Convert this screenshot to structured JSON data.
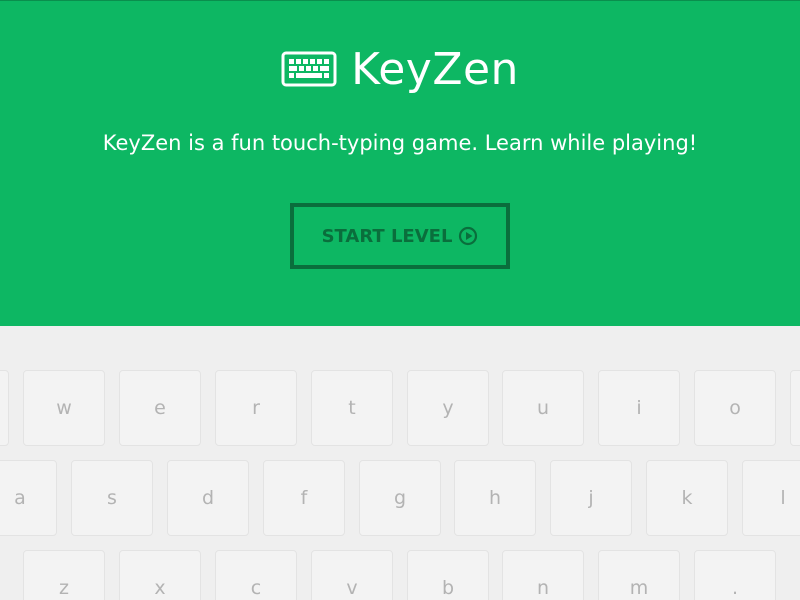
{
  "app": {
    "title": "KeyZen",
    "tagline": "KeyZen is a fun touch-typing game. Learn while playing!",
    "start_button_label": "START LEVEL",
    "colors": {
      "hero_background": "#0db763",
      "button_border": "#0a6e3c",
      "keyboard_background": "#efefef",
      "key_label": "#b3b3b3"
    },
    "icons": {
      "title": "keyboard-icon",
      "start_button": "play-circle-icon"
    }
  },
  "keyboard": {
    "row1": [
      "w",
      "e",
      "r",
      "t",
      "y",
      "u",
      "i",
      "o"
    ],
    "row2": [
      "a",
      "s",
      "d",
      "f",
      "g",
      "h",
      "j",
      "k",
      "l"
    ],
    "row3": [
      "z",
      "x",
      "c",
      "v",
      "b",
      "n",
      "m",
      "."
    ]
  }
}
